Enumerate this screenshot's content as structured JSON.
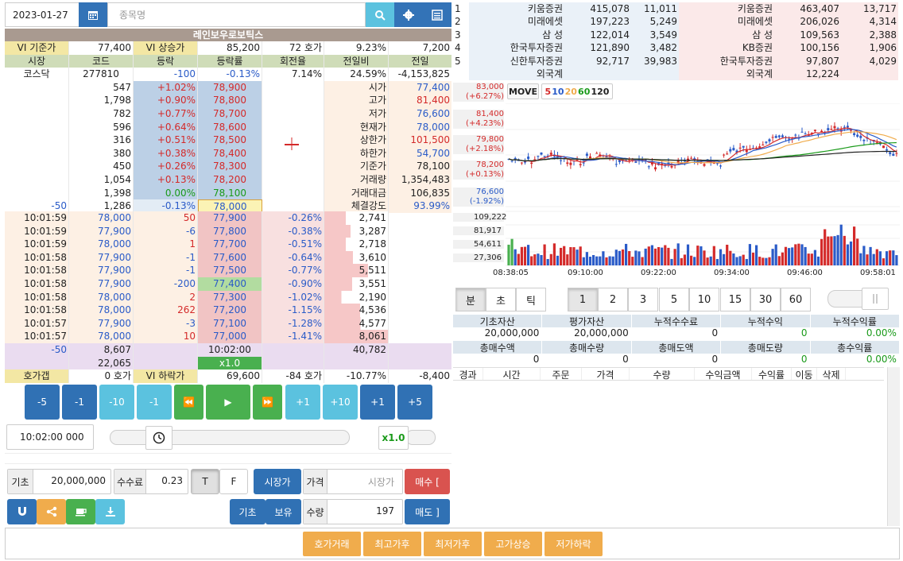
{
  "topbar": {
    "date": "2023-01-27",
    "search_placeholder": "종목명"
  },
  "stock": {
    "name": "레인보우로보틱스"
  },
  "vi": {
    "base_label": "VI 기준가",
    "base": "77,400",
    "up_label": "VI 상승가",
    "up": "85,200",
    "hoga": "72 호가",
    "pct": "9.23%",
    "diff": "7,200"
  },
  "headers": [
    "시장",
    "코드",
    "등락",
    "등락률",
    "회전율",
    "전일비",
    "전일"
  ],
  "info": {
    "market": "코스닥",
    "code": "277810",
    "change": "-100",
    "rate": "-0.13%",
    "turnover": "7.14%",
    "prev_ratio": "24.59%",
    "prev": "-4,153,825"
  },
  "asks": [
    {
      "qty": "547",
      "rate": "+1.02%",
      "price": "78,900"
    },
    {
      "qty": "1,798",
      "rate": "+0.90%",
      "price": "78,800"
    },
    {
      "qty": "782",
      "rate": "+0.77%",
      "price": "78,700"
    },
    {
      "qty": "596",
      "rate": "+0.64%",
      "price": "78,600"
    },
    {
      "qty": "316",
      "rate": "+0.51%",
      "price": "78,500"
    },
    {
      "qty": "380",
      "rate": "+0.38%",
      "price": "78,400"
    },
    {
      "qty": "450",
      "rate": "+0.26%",
      "price": "78,300"
    },
    {
      "qty": "1,054",
      "rate": "+0.13%",
      "price": "78,200"
    },
    {
      "qty": "1,398",
      "rate": "0.00%",
      "price": "78,100"
    },
    {
      "diff": "-50",
      "qty": "1,286",
      "rate": "-0.13%",
      "price": "78,000"
    }
  ],
  "quote": [
    {
      "k": "시가",
      "v": "77,400"
    },
    {
      "k": "고가",
      "v": "81,400"
    },
    {
      "k": "저가",
      "v": "76,600"
    },
    {
      "k": "현재가",
      "v": "78,000"
    },
    {
      "k": "상한가",
      "v": "101,500"
    },
    {
      "k": "하한가",
      "v": "54,700"
    },
    {
      "k": "기준가",
      "v": "78,100"
    },
    {
      "k": "거래량",
      "v": "1,354,483"
    },
    {
      "k": "거래대금",
      "v": "106,835"
    },
    {
      "k": "체결강도",
      "v": "93.99%"
    }
  ],
  "trades": [
    {
      "t": "10:01:59",
      "p": "78,000",
      "c": "50",
      "bid": "77,900",
      "r": "-0.26%",
      "q": "2,741"
    },
    {
      "t": "10:01:59",
      "p": "77,900",
      "c": "-6",
      "bid": "77,800",
      "r": "-0.38%",
      "q": "3,287"
    },
    {
      "t": "10:01:59",
      "p": "78,000",
      "c": "1",
      "bid": "77,700",
      "r": "-0.51%",
      "q": "2,718"
    },
    {
      "t": "10:01:58",
      "p": "77,900",
      "c": "-1",
      "bid": "77,600",
      "r": "-0.64%",
      "q": "3,610"
    },
    {
      "t": "10:01:58",
      "p": "77,900",
      "c": "-1",
      "bid": "77,500",
      "r": "-0.77%",
      "q": "5,511"
    },
    {
      "t": "10:01:58",
      "p": "77,900",
      "c": "-200",
      "bid": "77,400",
      "r": "-0.90%",
      "q": "3,551"
    },
    {
      "t": "10:01:58",
      "p": "78,000",
      "c": "2",
      "bid": "77,300",
      "r": "-1.02%",
      "q": "2,190"
    },
    {
      "t": "10:01:58",
      "p": "78,000",
      "c": "262",
      "bid": "77,200",
      "r": "-1.15%",
      "q": "4,536"
    },
    {
      "t": "10:01:57",
      "p": "77,900",
      "c": "-3",
      "bid": "77,100",
      "r": "-1.28%",
      "q": "4,577"
    },
    {
      "t": "10:01:57",
      "p": "78,000",
      "c": "10",
      "bid": "77,000",
      "r": "-1.41%",
      "q": "8,061"
    }
  ],
  "summary": {
    "diff": "-50",
    "ask_total": "8,607",
    "time": "10:02:00",
    "bid_total": "40,782",
    "extra": "22,065",
    "speed": "x1.0"
  },
  "vi_down": {
    "gap_label": "호가갭",
    "gap": "0 호가",
    "down_label": "VI 하락가",
    "down": "69,600",
    "hoga": "-84 호가",
    "pct": "-10.77%",
    "diff": "-8,400"
  },
  "play_buttons": [
    "-5",
    "-1",
    "-10",
    "-1",
    "⏪",
    "▶",
    "⏩",
    "+1",
    "+10",
    "+1",
    "+5"
  ],
  "time_field": "10:02:00 000",
  "speed_label": "x1.0",
  "order": {
    "base_label": "기초",
    "base": "20,000,000",
    "fee_label": "수수료",
    "fee": "0.23",
    "t": "T",
    "f": "F",
    "market_btn": "시장가",
    "price_label": "가격",
    "price_ph": "시장가",
    "buy": "매수 [",
    "basic": "기초",
    "hold": "보유",
    "qty_label": "수량",
    "qty": "197",
    "sell": "매도 ]"
  },
  "brokers": [
    {
      "n": "1",
      "sell": "키움증권",
      "sq": "415,078",
      "sc": "11,011",
      "buy": "키움증권",
      "bq": "463,407",
      "bc": "13,717"
    },
    {
      "n": "2",
      "sell": "미래에셋",
      "sq": "197,223",
      "sc": "5,249",
      "buy": "미래에셋",
      "bq": "206,026",
      "bc": "4,314"
    },
    {
      "n": "3",
      "sell": "삼 성",
      "sq": "122,014",
      "sc": "3,549",
      "buy": "삼 성",
      "bq": "109,563",
      "bc": "2,388"
    },
    {
      "n": "4",
      "sell": "한국투자증권",
      "sq": "121,890",
      "sc": "3,482",
      "buy": "KB증권",
      "bq": "100,156",
      "bc": "1,906"
    },
    {
      "n": "5",
      "sell": "신한투자증권",
      "sq": "92,717",
      "sc": "39,983",
      "buy": "한국투자증권",
      "bq": "97,807",
      "bc": "4,029"
    }
  ],
  "foreign": {
    "sell_label": "외국계",
    "buy_label": "외국계",
    "buy_qty": "12,224"
  },
  "chart": {
    "move": "MOVE",
    "ma": [
      "5",
      "10",
      "20",
      "60",
      "120"
    ],
    "price_labels": [
      {
        "v": "83,000",
        "p": "(+6.27%)",
        "c": "#d42a2a"
      },
      {
        "v": "81,400",
        "p": "(+4.23%)",
        "c": "#d42a2a"
      },
      {
        "v": "79,800",
        "p": "(+2.18%)",
        "c": "#d42a2a"
      },
      {
        "v": "78,200",
        "p": "(+0.13%)",
        "c": "#d42a2a"
      },
      {
        "v": "76,600",
        "p": "(-1.92%)",
        "c": "#2a5bc8"
      }
    ],
    "vol_labels": [
      "109,222",
      "81,917",
      "54,611",
      "27,306"
    ],
    "times": [
      "08:38:05",
      "09:10:00",
      "09:22:00",
      "09:34:00",
      "09:46:00",
      "09:58:01"
    ]
  },
  "segments1": [
    "분",
    "초",
    "틱"
  ],
  "segments2": [
    "1",
    "2",
    "3",
    "5",
    "10",
    "15",
    "30",
    "60"
  ],
  "assets": {
    "headers": [
      "기초자산",
      "평가자산",
      "누적수수료",
      "누적수익",
      "누적수익률"
    ],
    "values": [
      "20,000,000",
      "20,000,000",
      "0",
      "0",
      "0.00%"
    ],
    "headers2": [
      "총매수액",
      "총매수량",
      "총매도액",
      "총매도량",
      "총수익률"
    ],
    "values2": [
      "0",
      "0",
      "0",
      "0",
      "0.00%"
    ]
  },
  "order_headers": [
    "경과",
    "시간",
    "주문",
    "가격",
    "수량",
    "수익금액",
    "수익률",
    "이동",
    "삭제"
  ],
  "bottom_buttons": [
    "호가거래",
    "최고가후",
    "최저가후",
    "고가상승",
    "저가하락"
  ]
}
